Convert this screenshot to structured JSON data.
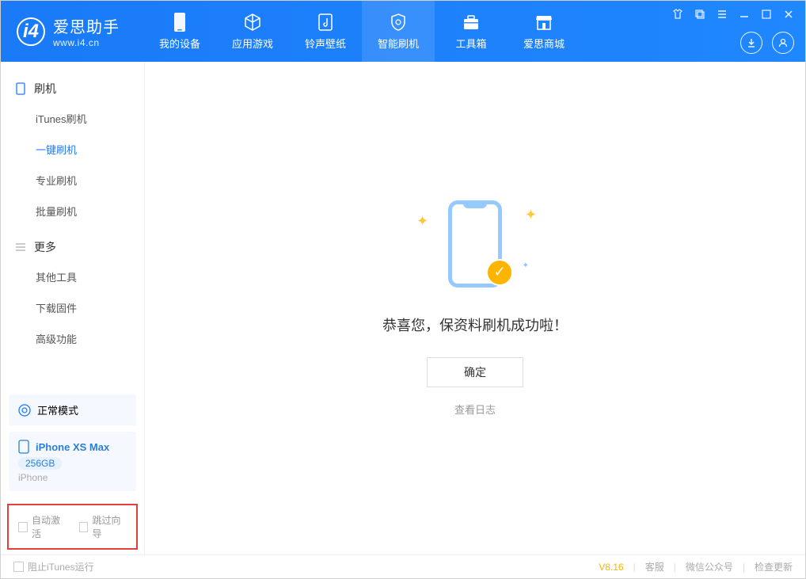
{
  "app": {
    "title": "爱思助手",
    "subtitle": "www.i4.cn"
  },
  "nav": [
    {
      "label": "我的设备"
    },
    {
      "label": "应用游戏"
    },
    {
      "label": "铃声壁纸"
    },
    {
      "label": "智能刷机",
      "active": true
    },
    {
      "label": "工具箱"
    },
    {
      "label": "爱思商城"
    }
  ],
  "sidebar": {
    "flash": {
      "title": "刷机",
      "items": [
        {
          "label": "iTunes刷机"
        },
        {
          "label": "一键刷机",
          "active": true
        },
        {
          "label": "专业刷机"
        },
        {
          "label": "批量刷机"
        }
      ]
    },
    "more": {
      "title": "更多",
      "items": [
        {
          "label": "其他工具"
        },
        {
          "label": "下载固件"
        },
        {
          "label": "高级功能"
        }
      ]
    }
  },
  "device_mode": "正常模式",
  "device": {
    "name": "iPhone XS Max",
    "capacity": "256GB",
    "type": "iPhone"
  },
  "options": {
    "auto_activate": "自动激活",
    "skip_guide": "跳过向导"
  },
  "main": {
    "success_msg": "恭喜您，保资料刷机成功啦！",
    "ok_btn": "确定",
    "view_log": "查看日志"
  },
  "footer": {
    "block_itunes": "阻止iTunes运行",
    "version": "V8.16",
    "links": {
      "service": "客服",
      "wechat": "微信公众号",
      "update": "检查更新"
    }
  }
}
